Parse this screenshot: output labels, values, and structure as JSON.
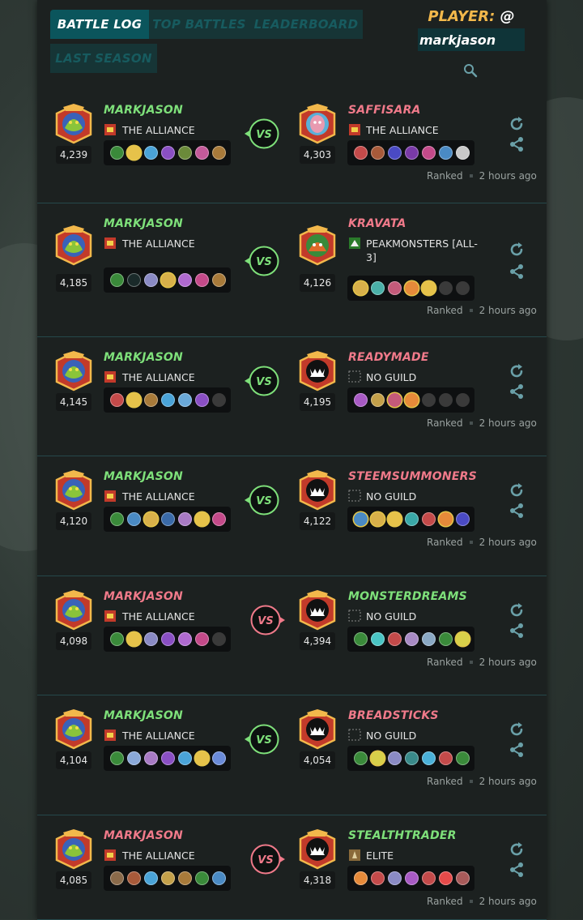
{
  "tabs": [
    {
      "label": "BATTLE LOG",
      "active": true
    },
    {
      "label": "TOP BATTLES",
      "active": false
    },
    {
      "label": "LEADERBOARD",
      "active": false
    },
    {
      "label": "LAST SEASON",
      "active": false
    }
  ],
  "player": {
    "label": "PLAYER:",
    "at": "@",
    "value": "markjason"
  },
  "colors": {
    "win": "#7ee07a",
    "lose": "#f07a8a",
    "accent": "#0b555c"
  },
  "battles": [
    {
      "left": {
        "name": "MARKJASON",
        "guild": "THE ALLIANCE",
        "rating": "4,239",
        "status": "win",
        "avatar": "green-monster"
      },
      "right": {
        "name": "SAFFISARA",
        "guild": "THE ALLIANCE",
        "rating": "4,303",
        "status": "lose",
        "avatar": "pink-monster"
      },
      "winner": "left",
      "left_cards": [
        "#3a8a3a",
        "#e6c24a",
        "#4aa3d8",
        "#8a4fc4",
        "#6b8a3a",
        "#c45a9a",
        "#a87a3a"
      ],
      "right_cards": [
        "#c44a4a",
        "#a85a3a",
        "#4a4ac4",
        "#7a3aa8",
        "#c44a8a",
        "#4a8ac4",
        "#c8c8c8"
      ],
      "left_gold": [
        1
      ],
      "right_gold": [],
      "meta": {
        "mode": "Ranked",
        "time": "2 hours ago"
      }
    },
    {
      "left": {
        "name": "MARKJASON",
        "guild": "THE ALLIANCE",
        "rating": "4,185",
        "status": "win",
        "avatar": "green-monster"
      },
      "right": {
        "name": "KRAVATA",
        "guild": "PEAKMONSTERS [ALL-3]",
        "rating": "4,126",
        "status": "lose",
        "avatar": "orc-monster"
      },
      "winner": "left",
      "left_cards": [
        "#3a8a3a",
        "#1a2a2a",
        "#8a8ac4",
        "#d8b04a",
        "#b06ad0",
        "#c44a8a",
        "#a87a3a"
      ],
      "right_cards": [
        "#d8b04a",
        "#4ab0a8",
        "#c45a7a",
        "#e68a3a",
        "#e6c24a",
        "empty",
        "empty"
      ],
      "left_gold": [
        3
      ],
      "right_gold": [
        0,
        3,
        4
      ],
      "meta": {
        "mode": "Ranked",
        "time": "2 hours ago"
      }
    },
    {
      "left": {
        "name": "MARKJASON",
        "guild": "THE ALLIANCE",
        "rating": "4,145",
        "status": "win",
        "avatar": "green-monster"
      },
      "right": {
        "name": "READYMADE",
        "guild": "NO GUILD",
        "rating": "4,195",
        "status": "lose",
        "avatar": "dark-monster"
      },
      "winner": "left",
      "left_cards": [
        "#c44a4a",
        "#e6c24a",
        "#a87a3a",
        "#4aa3d8",
        "#6aa8d8",
        "#8a4fc4",
        "empty"
      ],
      "right_cards": [
        "#a85ac4",
        "#c4a04a",
        "#c45a7a",
        "#e68a3a",
        "empty",
        "empty",
        "empty"
      ],
      "left_gold": [
        1
      ],
      "right_gold": [
        2,
        3
      ],
      "meta": {
        "mode": "Ranked",
        "time": "2 hours ago"
      }
    },
    {
      "left": {
        "name": "MARKJASON",
        "guild": "THE ALLIANCE",
        "rating": "4,120",
        "status": "win",
        "avatar": "green-monster"
      },
      "right": {
        "name": "STEEMSUMMONERS",
        "guild": "NO GUILD",
        "rating": "4,122",
        "status": "lose",
        "avatar": "dark-monster"
      },
      "winner": "left",
      "left_cards": [
        "#3a8a3a",
        "#4a8ac4",
        "#d8b04a",
        "#3a6aa8",
        "#a87ac4",
        "#e6c24a",
        "#c44a8a"
      ],
      "right_cards": [
        "#4a8ac4",
        "#d8b04a",
        "#e6c24a",
        "#3aa8a8",
        "#c44a4a",
        "#e68a3a",
        "#4a4ac4"
      ],
      "left_gold": [
        2,
        5
      ],
      "right_gold": [
        0,
        1,
        2,
        5
      ],
      "meta": {
        "mode": "Ranked",
        "time": "2 hours ago"
      }
    },
    {
      "left": {
        "name": "MARKJASON",
        "guild": "THE ALLIANCE",
        "rating": "4,098",
        "status": "lose",
        "avatar": "green-monster"
      },
      "right": {
        "name": "MONSTERDREAMS",
        "guild": "NO GUILD",
        "rating": "4,394",
        "status": "win",
        "avatar": "dark-monster"
      },
      "winner": "right",
      "left_cards": [
        "#3a8a3a",
        "#e6c24a",
        "#8a8ac4",
        "#8a4fc4",
        "#b06ad0",
        "#c44a8a",
        "empty"
      ],
      "right_cards": [
        "#3a8a3a",
        "#4ac4c4",
        "#c44a4a",
        "#a88ac4",
        "#8aa8c4",
        "#3a8a3a",
        "#d8d04a"
      ],
      "left_gold": [
        1
      ],
      "right_gold": [
        6
      ],
      "meta": {
        "mode": "Ranked",
        "time": "2 hours ago"
      }
    },
    {
      "left": {
        "name": "MARKJASON",
        "guild": "THE ALLIANCE",
        "rating": "4,104",
        "status": "win",
        "avatar": "green-monster"
      },
      "right": {
        "name": "BREADSTICKS",
        "guild": "NO GUILD",
        "rating": "4,054",
        "status": "lose",
        "avatar": "dark-monster"
      },
      "winner": "left",
      "left_cards": [
        "#3a8a3a",
        "#8aa8d8",
        "#a87ac4",
        "#8a4fc4",
        "#4aa3d8",
        "#e6c24a",
        "#6a8ad8"
      ],
      "right_cards": [
        "#3a8a3a",
        "#d8d04a",
        "#8a8ac4",
        "#3a8a8a",
        "#4ab0d8",
        "#c44a4a",
        "#3a8a3a"
      ],
      "left_gold": [
        5
      ],
      "right_gold": [
        1
      ],
      "meta": {
        "mode": "Ranked",
        "time": "2 hours ago"
      }
    },
    {
      "left": {
        "name": "MARKJASON",
        "guild": "THE ALLIANCE",
        "rating": "4,085",
        "status": "lose",
        "avatar": "green-monster"
      },
      "right": {
        "name": "STEALTHTRADER",
        "guild": "ELITE",
        "rating": "4,318",
        "status": "win",
        "avatar": "dark-monster"
      },
      "winner": "right",
      "left_cards": [
        "#8a6a4a",
        "#a85a3a",
        "#4aa3d8",
        "#c4a04a",
        "#a87a3a",
        "#3a8a3a",
        "#4a8ac4"
      ],
      "right_cards": [
        "#e68a3a",
        "#c44a4a",
        "#8a8ac4",
        "#a85ac4",
        "#c44a4a",
        "#e64a4a",
        "#a85a5a"
      ],
      "left_gold": [],
      "right_gold": [],
      "meta": {
        "mode": "Ranked",
        "time": "2 hours ago"
      }
    }
  ]
}
